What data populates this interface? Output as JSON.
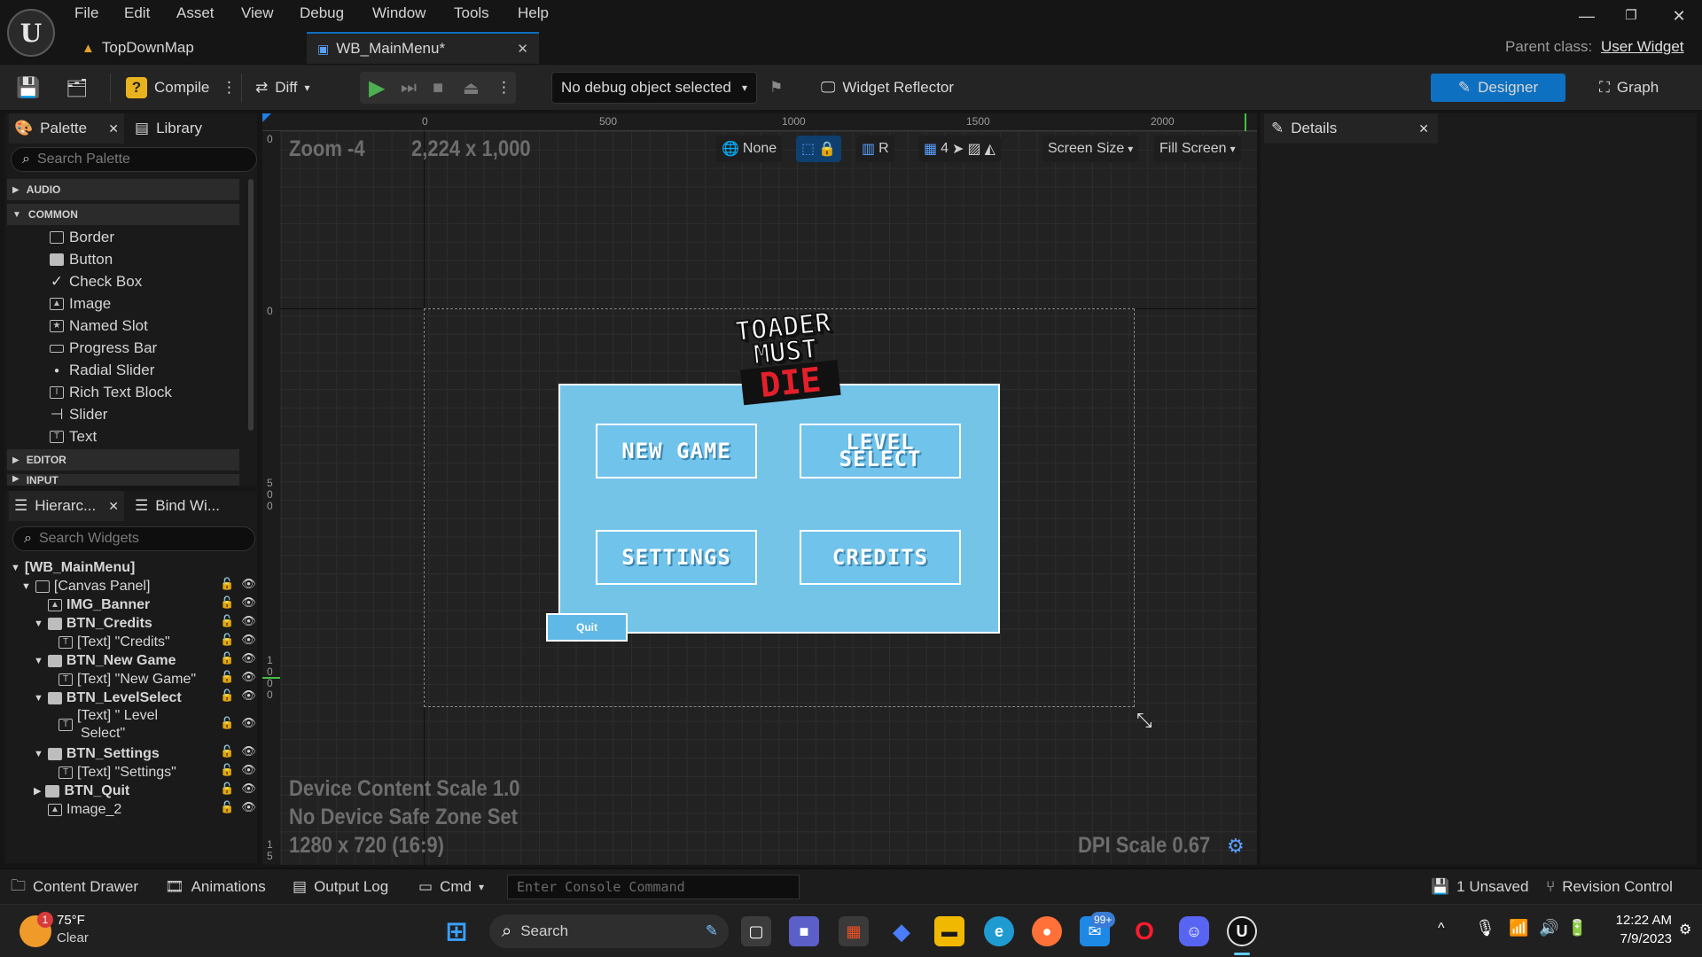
{
  "menu": [
    "File",
    "Edit",
    "Asset",
    "View",
    "Debug",
    "Window",
    "Tools",
    "Help"
  ],
  "tabs": [
    {
      "label": "TopDownMap"
    },
    {
      "label": "WB_MainMenu*"
    }
  ],
  "parent_class": {
    "label": "Parent class:",
    "value": "User Widget"
  },
  "toolbar": {
    "compile": "Compile",
    "diff": "Diff",
    "debug_object": "No debug object selected",
    "widget_reflector": "Widget Reflector",
    "designer": "Designer",
    "graph": "Graph"
  },
  "palette": {
    "tab_palette": "Palette",
    "tab_library": "Library",
    "search_placeholder": "Search Palette",
    "categories": {
      "audio": "AUDIO",
      "common": "COMMON",
      "editor": "EDITOR",
      "input": "INPUT"
    },
    "items": [
      "Border",
      "Button",
      "Check Box",
      "Image",
      "Named Slot",
      "Progress Bar",
      "Radial Slider",
      "Rich Text Block",
      "Slider",
      "Text"
    ]
  },
  "hierarchy": {
    "tab_hierarchy": "Hierarc...",
    "tab_bind": "Bind Wi...",
    "search_placeholder": "Search Widgets",
    "rows": [
      "[WB_MainMenu]",
      "[Canvas Panel]",
      "IMG_Banner",
      "BTN_Credits",
      "[Text] \"Credits\"",
      "BTN_New Game",
      "[Text] \"New Game\"",
      "BTN_LevelSelect",
      "[Text] \" Level",
      "Select\"",
      "BTN_Settings",
      "[Text] \"Settings\"",
      "BTN_Quit",
      "Image_2"
    ]
  },
  "details": {
    "title": "Details"
  },
  "viewport": {
    "zoom": "Zoom -4",
    "resolution": "2,224 x 1,000",
    "tools": {
      "none": "None",
      "r": "R",
      "grid": "4",
      "screen_size": "Screen Size",
      "fill_screen": "Fill Screen"
    },
    "ruler_top": [
      "0",
      "500",
      "1000",
      "1500",
      "2000"
    ],
    "ruler_left": [
      "0",
      "0",
      "5",
      "0",
      "0",
      "1",
      "0",
      "0",
      "0",
      "1",
      "5"
    ],
    "device_scale": "Device Content Scale 1.0",
    "safe_zone": "No Device Safe Zone Set",
    "screen": "1280 x 720 (16:9)",
    "dpi": "DPI Scale 0.67"
  },
  "game_menu": {
    "logo": [
      "TOADER",
      "MUST",
      "DIE"
    ],
    "new_game": "NEW GAME",
    "level_select_1": "LEVEL",
    "level_select_2": "SELECT",
    "settings": "SETTINGS",
    "credits": "CREDITS",
    "quit": "Quit",
    "panel_color": "#74c4e8"
  },
  "statusbar": {
    "content_drawer": "Content Drawer",
    "animations": "Animations",
    "output_log": "Output Log",
    "cmd": "Cmd",
    "console_placeholder": "Enter Console Command",
    "unsaved": "1 Unsaved",
    "revision": "Revision Control"
  },
  "taskbar": {
    "weather_temp": "75°F",
    "weather_desc": "Clear",
    "weather_badge": "1",
    "search": "Search",
    "mail_badge": "99+",
    "time": "12:22 AM",
    "date": "7/9/2023"
  },
  "colors": {
    "accent": "#0e70c0",
    "play": "#4caf50"
  }
}
